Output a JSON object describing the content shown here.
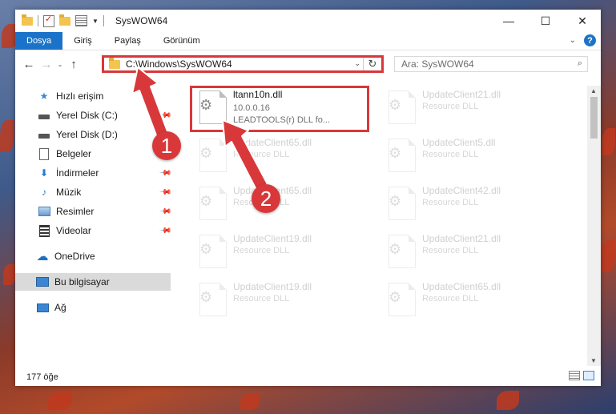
{
  "window": {
    "title": "SysWOW64"
  },
  "window_controls": {
    "minimize": "—",
    "maximize": "☐",
    "close": "✕"
  },
  "ribbon": {
    "tabs": [
      "Dosya",
      "Giriş",
      "Paylaş",
      "Görünüm"
    ],
    "help": "?"
  },
  "address": {
    "path": "C:\\Windows\\SysWOW64"
  },
  "search": {
    "placeholder": "Ara: SysWOW64"
  },
  "sidebar": {
    "items": [
      {
        "label": "Hızlı erişim",
        "icon": "star-icon",
        "pinned": false
      },
      {
        "label": "Yerel Disk (C:)",
        "icon": "drive-icon",
        "pinned": true
      },
      {
        "label": "Yerel Disk (D:)",
        "icon": "drive-icon",
        "pinned": true
      },
      {
        "label": "Belgeler",
        "icon": "document-icon",
        "pinned": true
      },
      {
        "label": "İndirmeler",
        "icon": "download-icon",
        "pinned": true
      },
      {
        "label": "Müzik",
        "icon": "music-icon",
        "pinned": true
      },
      {
        "label": "Resimler",
        "icon": "pictures-icon",
        "pinned": true
      },
      {
        "label": "Videolar",
        "icon": "video-icon",
        "pinned": true
      },
      {
        "label": "OneDrive",
        "icon": "cloud-icon",
        "pinned": false
      },
      {
        "label": "Bu bilgisayar",
        "icon": "computer-icon",
        "pinned": false,
        "selected": true
      },
      {
        "label": "Ağ",
        "icon": "network-icon",
        "pinned": false
      }
    ]
  },
  "files": [
    {
      "name": "ltann10n.dll",
      "version": "10.0.0.16",
      "desc": "LEADTOOLS(r) DLL fo...",
      "highlighted": true
    },
    {
      "name": "UpdateClient21.dll",
      "desc": "Resource DLL"
    },
    {
      "name": "UpdateClient65.dll",
      "desc": "Resource DLL"
    },
    {
      "name": "UpdateClient5.dll",
      "desc": "Resource DLL"
    },
    {
      "name": "UpdateClient65.dll",
      "desc": "Resource DLL"
    },
    {
      "name": "UpdateClient42.dll",
      "desc": "Resource DLL"
    },
    {
      "name": "UpdateClient19.dll",
      "desc": "Resource DLL"
    },
    {
      "name": "UpdateClient21.dll",
      "desc": "Resource DLL"
    },
    {
      "name": "UpdateClient19.dll",
      "desc": "Resource DLL"
    },
    {
      "name": "UpdateClient65.dll",
      "desc": "Resource DLL"
    }
  ],
  "status": {
    "count": "177 öğe"
  },
  "annotations": {
    "step1": "1",
    "step2": "2",
    "color": "#d9383a"
  }
}
